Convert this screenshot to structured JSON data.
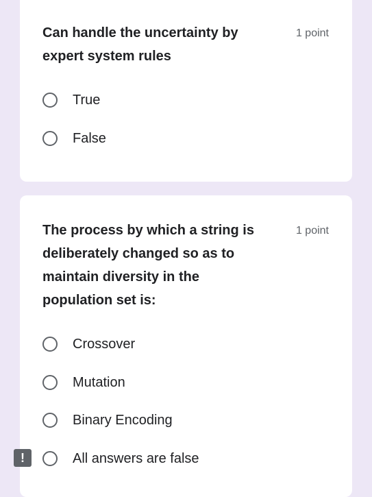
{
  "questions": [
    {
      "title": "Can handle the uncertainty by expert system rules",
      "points": "1 point",
      "options": [
        "True",
        "False"
      ]
    },
    {
      "title": "The process by which a string is deliberately changed so as to maintain diversity in the population set is:",
      "points": "1 point",
      "options": [
        "Crossover",
        "Mutation",
        "Binary Encoding",
        "All answers are false"
      ]
    }
  ],
  "feedback": {
    "icon": "report-issue-icon",
    "glyph": "!"
  },
  "colors": {
    "page_background": "#ede7f6",
    "card_background": "#ffffff",
    "text": "#202124",
    "secondary_text": "#5f6368"
  }
}
